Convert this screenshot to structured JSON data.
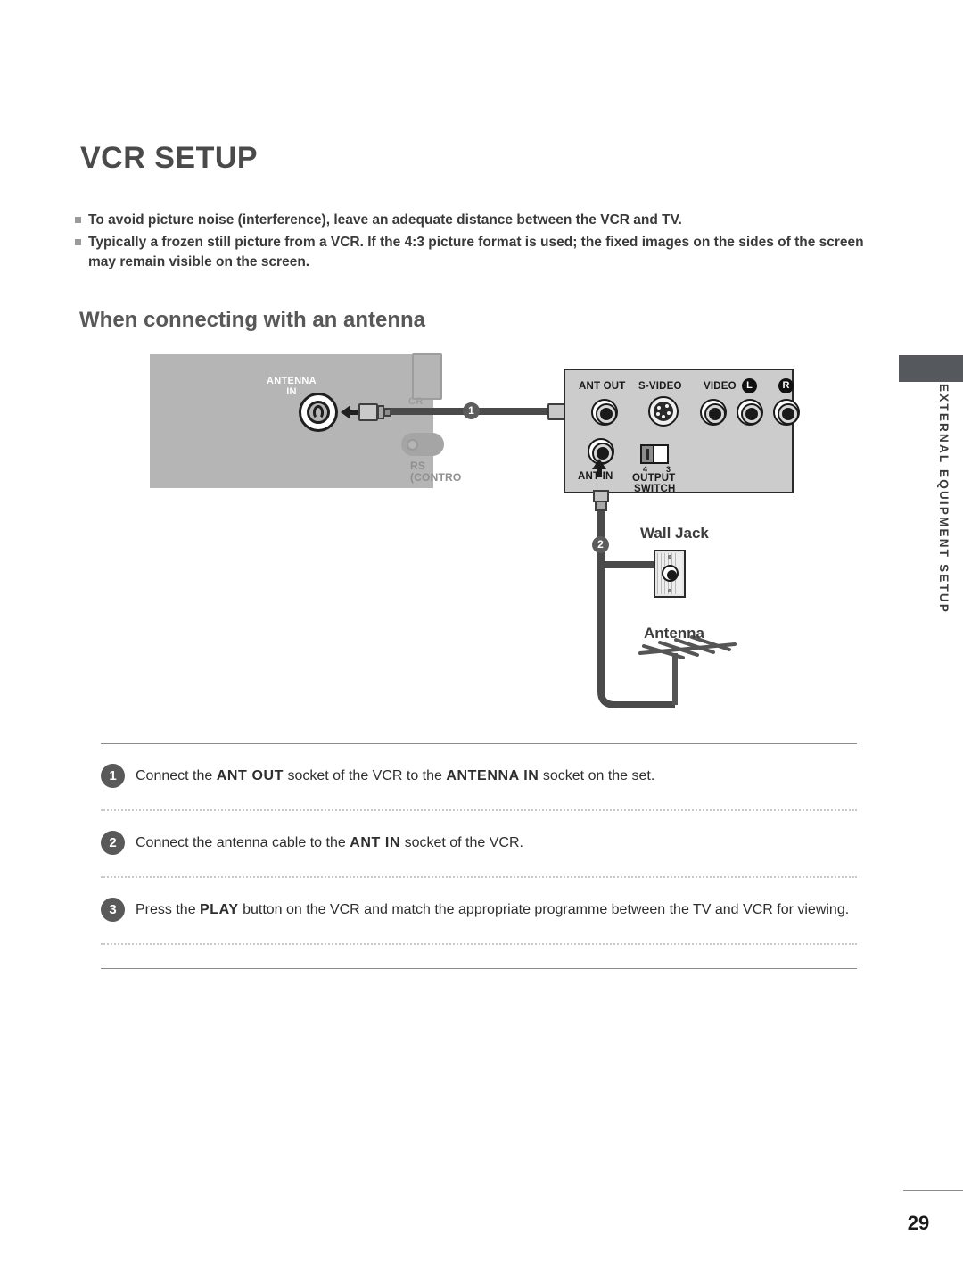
{
  "page": {
    "title": "VCR SETUP",
    "number": "29",
    "side_tab": "EXTERNAL EQUIPMENT SETUP"
  },
  "intro": {
    "bullets": [
      "To avoid picture noise (interference), leave an adequate distance between the VCR and TV.",
      "Typically a frozen still picture from a VCR. If the 4:3 picture format is used; the fixed images on the sides of the screen may remain visible on the screen."
    ]
  },
  "section": {
    "heading": "When connecting with an antenna"
  },
  "diagram": {
    "tv_panel": {
      "antenna_in_line1": "ANTENNA",
      "antenna_in_line2": "IN",
      "rs_label_top": "CR",
      "rs_label_line1": "RS",
      "rs_label_line2": "(CONTRO"
    },
    "vcr_panel": {
      "ant_out": "ANT OUT",
      "s_video": "S-VIDEO",
      "video": "VIDEO",
      "audio_left": "L",
      "audio_right": "R",
      "ant_in": "ANT IN",
      "output_switch_line1": "OUTPUT",
      "output_switch_line2": "SWITCH",
      "switch_pos_4": "4",
      "switch_pos_3": "3"
    },
    "callouts": {
      "one": "1",
      "two": "2"
    },
    "wall_jack_label": "Wall Jack",
    "antenna_label": "Antenna"
  },
  "steps": [
    {
      "number": "1",
      "parts": [
        {
          "t": "Connect the ",
          "b": false
        },
        {
          "t": "ANT OUT",
          "b": true
        },
        {
          "t": " socket of the VCR to the ",
          "b": false
        },
        {
          "t": "ANTENNA IN",
          "b": true
        },
        {
          "t": " socket on the set.",
          "b": false
        }
      ]
    },
    {
      "number": "2",
      "parts": [
        {
          "t": "Connect the antenna cable to the ",
          "b": false
        },
        {
          "t": "ANT IN",
          "b": true
        },
        {
          "t": " socket of the VCR.",
          "b": false
        }
      ]
    },
    {
      "number": "3",
      "parts": [
        {
          "t": "Press the ",
          "b": false
        },
        {
          "t": "PLAY",
          "b": true
        },
        {
          "t": " button on the VCR and match the appropriate programme between the TV and VCR for viewing.",
          "b": false
        }
      ]
    }
  ],
  "colors": {
    "tv_panel": "#b5b5b5",
    "vcr_panel": "#cccccc",
    "cable": "#4a4a4a",
    "badge": "#5c5c5c",
    "side_tab": "#55585c"
  }
}
